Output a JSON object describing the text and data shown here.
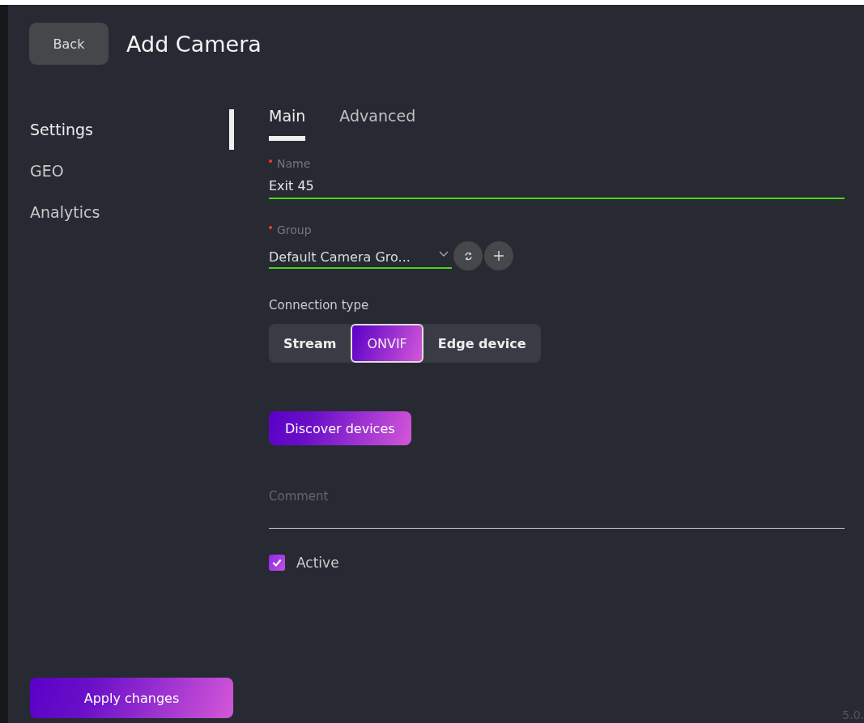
{
  "header": {
    "back_button": "Back",
    "title": "Add Camera"
  },
  "sidebar": {
    "items": [
      {
        "label": "Settings",
        "selected": true
      },
      {
        "label": "GEO",
        "selected": false
      },
      {
        "label": "Analytics",
        "selected": false
      }
    ],
    "apply_button": "Apply changes"
  },
  "tabs": [
    {
      "label": "Main",
      "selected": true
    },
    {
      "label": "Advanced",
      "selected": false
    }
  ],
  "fields": {
    "name": {
      "label": "Name",
      "required": true,
      "value": "Exit 45"
    },
    "group": {
      "label": "Group",
      "required": true,
      "value": "Default Camera Gro..."
    },
    "connection_type": {
      "label": "Connection type",
      "options": [
        {
          "label": "Stream",
          "selected": false
        },
        {
          "label": "ONVIF",
          "selected": true
        },
        {
          "label": "Edge device",
          "selected": false
        }
      ]
    },
    "discover_button": "Discover devices",
    "comment": {
      "placeholder": "Comment"
    },
    "active": {
      "label": "Active",
      "checked": true
    }
  },
  "version": "5.0."
}
